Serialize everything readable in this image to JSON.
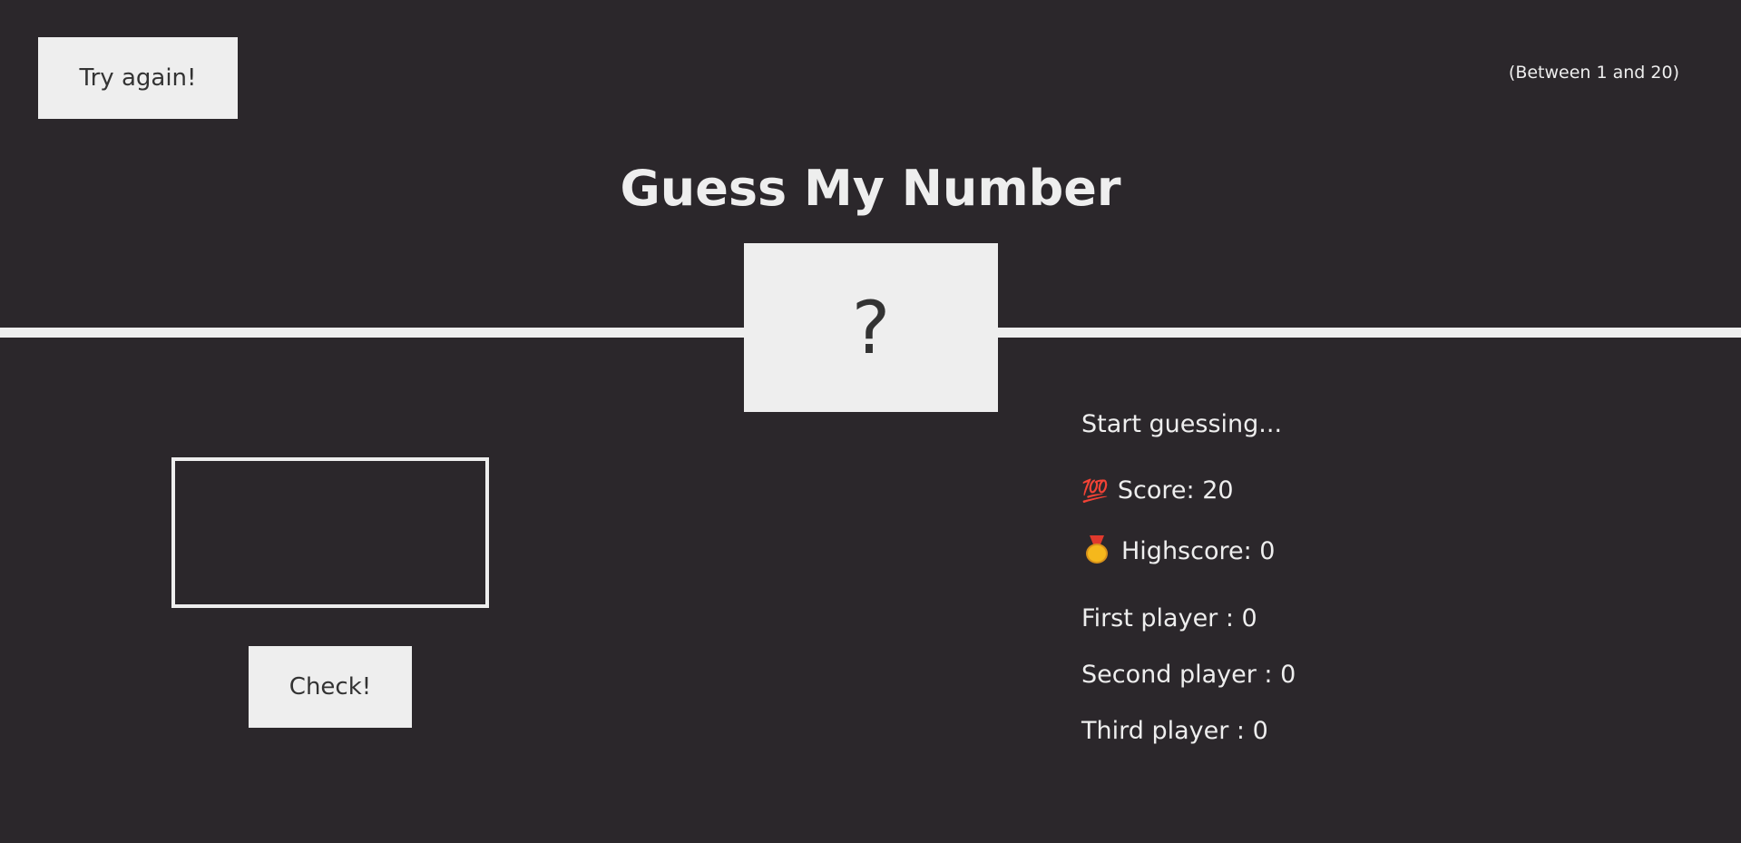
{
  "header": {
    "again_label": "Try again!",
    "between": "(Between 1 and 20)",
    "title": "Guess My Number"
  },
  "number_display": "?",
  "guess_input": {
    "value": ""
  },
  "check_label": "Check!",
  "stats": {
    "message": "Start guessing...",
    "score_icon": "💯",
    "score_label": "Score: 20",
    "highscore_icon": "medal-icon",
    "highscore_label": "Highscore: 0",
    "first_player": "First player : 0",
    "second_player": "Second player : 0",
    "third_player": "Third player : 0"
  },
  "colors": {
    "background": "#2b272b",
    "foreground": "#eeeeee",
    "button_text": "#333333"
  }
}
